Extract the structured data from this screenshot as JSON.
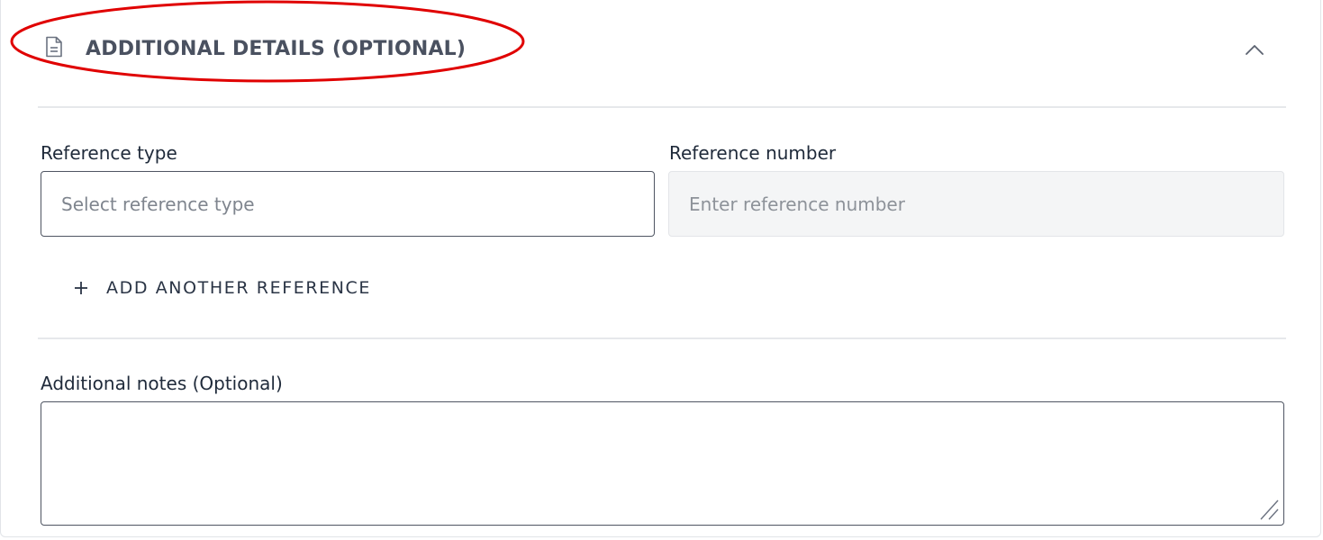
{
  "section": {
    "title": "ADDITIONAL DETAILS (OPTIONAL)",
    "header_icon": "document-icon",
    "toggle_icon": "chevron-up-icon",
    "expanded": true
  },
  "reference": {
    "type_label": "Reference type",
    "type_placeholder": "Select reference type",
    "type_value": "",
    "number_label": "Reference number",
    "number_placeholder": "Enter reference number",
    "number_value": "",
    "add_another_label": "ADD ANOTHER REFERENCE",
    "add_icon": "plus-icon"
  },
  "notes": {
    "label": "Additional notes (Optional)",
    "value": ""
  },
  "colors": {
    "annotation": "#e00000",
    "text": "#1f2a3a",
    "muted_title": "#4a5160",
    "divider": "#e6e8eb",
    "disabled_field_bg": "#f4f5f6"
  }
}
